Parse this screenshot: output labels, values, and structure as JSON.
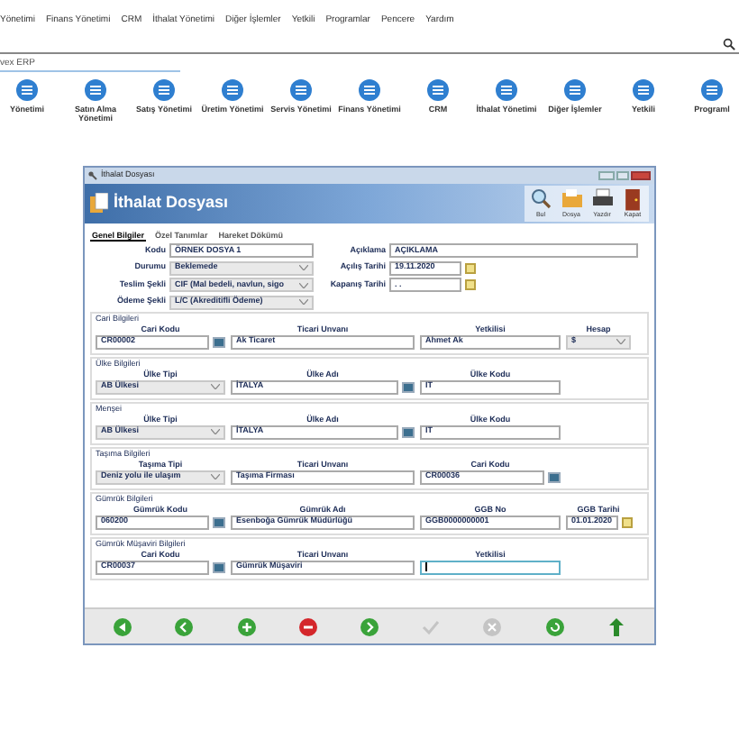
{
  "menu": [
    "Yönetimi",
    "Finans Yönetimi",
    "CRM",
    "İthalat Yönetimi",
    "Diğer İşlemler",
    "Yetkili",
    "Programlar",
    "Pencere",
    "Yardım"
  ],
  "breadcrumb": "vex ERP",
  "modules": [
    "Yönetimi",
    "Satın Alma Yönetimi",
    "Satış Yönetimi",
    "Üretim Yönetimi",
    "Servis Yönetimi",
    "Finans Yönetimi",
    "CRM",
    "İthalat Yönetimi",
    "Diğer İşlemler",
    "Yetkili",
    "Programl"
  ],
  "dialog": {
    "title": "İthalat Dosyası",
    "heading": "İthalat Dosyası",
    "tools": [
      {
        "label": "Bul",
        "kind": "search"
      },
      {
        "label": "Dosya",
        "kind": "folder"
      },
      {
        "label": "Yazdır",
        "kind": "print"
      },
      {
        "label": "Kapat",
        "kind": "exit"
      }
    ],
    "tabs": [
      {
        "label": "Genel Bilgiler",
        "selected": true
      },
      {
        "label": "Özel Tanımlar",
        "selected": false
      },
      {
        "label": "Hareket Dökümü",
        "selected": false
      }
    ],
    "left_fields": [
      {
        "label": "Kodu",
        "value": "ÖRNEK DOSYA 1",
        "kind": "text"
      },
      {
        "label": "Durumu",
        "value": "Beklemede",
        "kind": "select"
      },
      {
        "label": "Teslim Şekli",
        "value": "CIF (Mal bedeli, navlun, sigo",
        "kind": "select"
      },
      {
        "label": "Ödeme Şekli",
        "value": "L/C (Akreditifli Ödeme)",
        "kind": "select"
      }
    ],
    "right_fields": [
      {
        "label": "Açıklama",
        "value": "AÇIKLAMA",
        "kind": "wide"
      },
      {
        "label": "Açılış Tarihi",
        "value": "19.11.2020",
        "kind": "date"
      },
      {
        "label": "Kapanış Tarihi",
        "value": ". .",
        "kind": "date"
      }
    ],
    "sections": [
      {
        "title": "Cari Bilgileri",
        "columns": [
          {
            "label": "Cari Kodu",
            "value": "CR00002",
            "kind": "lookup"
          },
          {
            "label": "Ticari Unvanı",
            "value": "Ak Ticaret",
            "kind": "text"
          },
          {
            "label": "Yetkilisi",
            "value": "Ahmet Ak",
            "kind": "text"
          },
          {
            "label": "Hesap",
            "value": "$",
            "kind": "select"
          }
        ]
      },
      {
        "title": "Ülke Bilgileri",
        "columns": [
          {
            "label": "Ülke Tipi",
            "value": "AB Ülkesi",
            "kind": "select"
          },
          {
            "label": "Ülke Adı",
            "value": "İTALYA",
            "kind": "lookup"
          },
          {
            "label": "Ülke Kodu",
            "value": "IT",
            "kind": "text"
          }
        ]
      },
      {
        "title": "Menşei",
        "columns": [
          {
            "label": "Ülke Tipi",
            "value": "AB Ülkesi",
            "kind": "select"
          },
          {
            "label": "Ülke Adı",
            "value": "İTALYA",
            "kind": "lookup"
          },
          {
            "label": "Ülke Kodu",
            "value": "IT",
            "kind": "text"
          }
        ]
      },
      {
        "title": "Taşıma Bilgileri",
        "columns": [
          {
            "label": "Taşıma Tipi",
            "value": "Deniz yolu ile ulaşım",
            "kind": "select"
          },
          {
            "label": "Ticari Unvanı",
            "value": "Taşıma Firması",
            "kind": "text"
          },
          {
            "label": "Cari Kodu",
            "value": "CR00036",
            "kind": "lookup"
          }
        ]
      },
      {
        "title": "Gümrük Bilgileri",
        "columns": [
          {
            "label": "Gümrük Kodu",
            "value": "060200",
            "kind": "lookup"
          },
          {
            "label": "Gümrük Adı",
            "value": "Esenboğa Gümrük Müdürlüğü",
            "kind": "text"
          },
          {
            "label": "GGB No",
            "value": "GGB0000000001",
            "kind": "text"
          },
          {
            "label": "GGB Tarihi",
            "value": "01.01.2020",
            "kind": "date"
          }
        ]
      },
      {
        "title": "Gümrük Müşaviri Bilgileri",
        "columns": [
          {
            "label": "Cari Kodu",
            "value": "CR00037",
            "kind": "lookup"
          },
          {
            "label": "Ticari Unvanı",
            "value": "Gümrük Müşaviri",
            "kind": "text"
          },
          {
            "label": "Yetkilisi",
            "kind": "focused"
          }
        ]
      }
    ],
    "nav": [
      {
        "kind": "first",
        "disabled": false
      },
      {
        "kind": "prev",
        "disabled": false
      },
      {
        "kind": "add",
        "disabled": false
      },
      {
        "kind": "delete",
        "disabled": false
      },
      {
        "kind": "next",
        "disabled": false
      },
      {
        "kind": "save",
        "disabled": true
      },
      {
        "kind": "cancel",
        "disabled": true
      },
      {
        "kind": "refresh",
        "disabled": false
      },
      {
        "kind": "up",
        "disabled": false
      }
    ]
  }
}
